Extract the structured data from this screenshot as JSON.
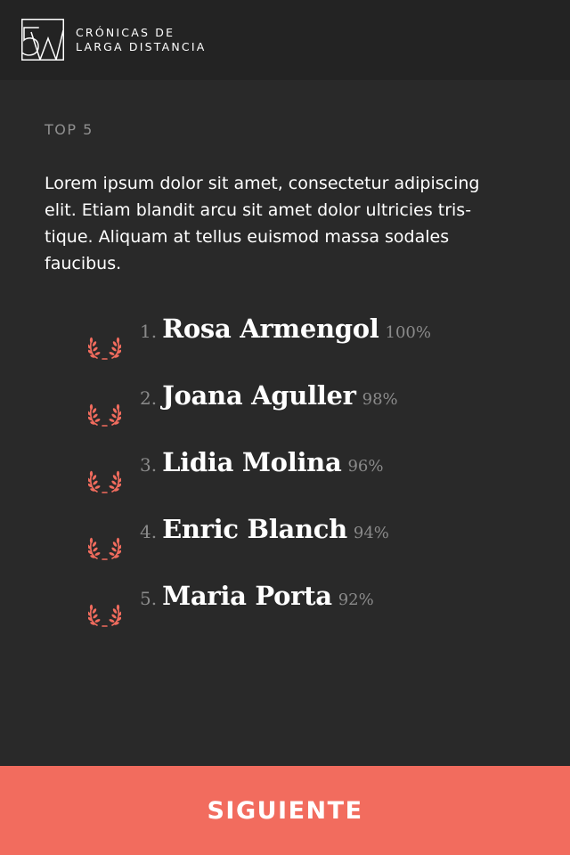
{
  "header": {
    "logo_text": "5W",
    "brand_line_1": "CRÓNICAS DE",
    "brand_line_2": "LARGA DISTANCIA"
  },
  "section": {
    "label": "TOP 5"
  },
  "intro": {
    "lines": [
      "Lorem ipsum dolor sit amet, consectetur adipiscing",
      "elit. Etiam blandit arcu sit amet dolor ultricies tris-",
      "tique. Aliquam at tellus euismod massa sodales",
      "faucibus."
    ]
  },
  "ranking": [
    {
      "num": "1.",
      "name": "Rosa Armengol",
      "pct": "100%",
      "icon": "laurel-icon"
    },
    {
      "num": "2.",
      "name": "Joana Aguller",
      "pct": "98%",
      "icon": "laurel-icon"
    },
    {
      "num": "3.",
      "name": "Lidia Molina",
      "pct": "96%",
      "icon": "laurel-icon"
    },
    {
      "num": "4.",
      "name": "Enric Blanch",
      "pct": "94%",
      "icon": "laurel-icon"
    },
    {
      "num": "5.",
      "name": "Maria Porta",
      "pct": "92%",
      "icon": "laurel-icon"
    }
  ],
  "footer": {
    "next_label": "SIGUIENTE"
  },
  "colors": {
    "background": "#292929",
    "header_background": "#232323",
    "accent": "#f26c5e",
    "muted_text": "#8a8a8a",
    "text": "#ffffff"
  }
}
